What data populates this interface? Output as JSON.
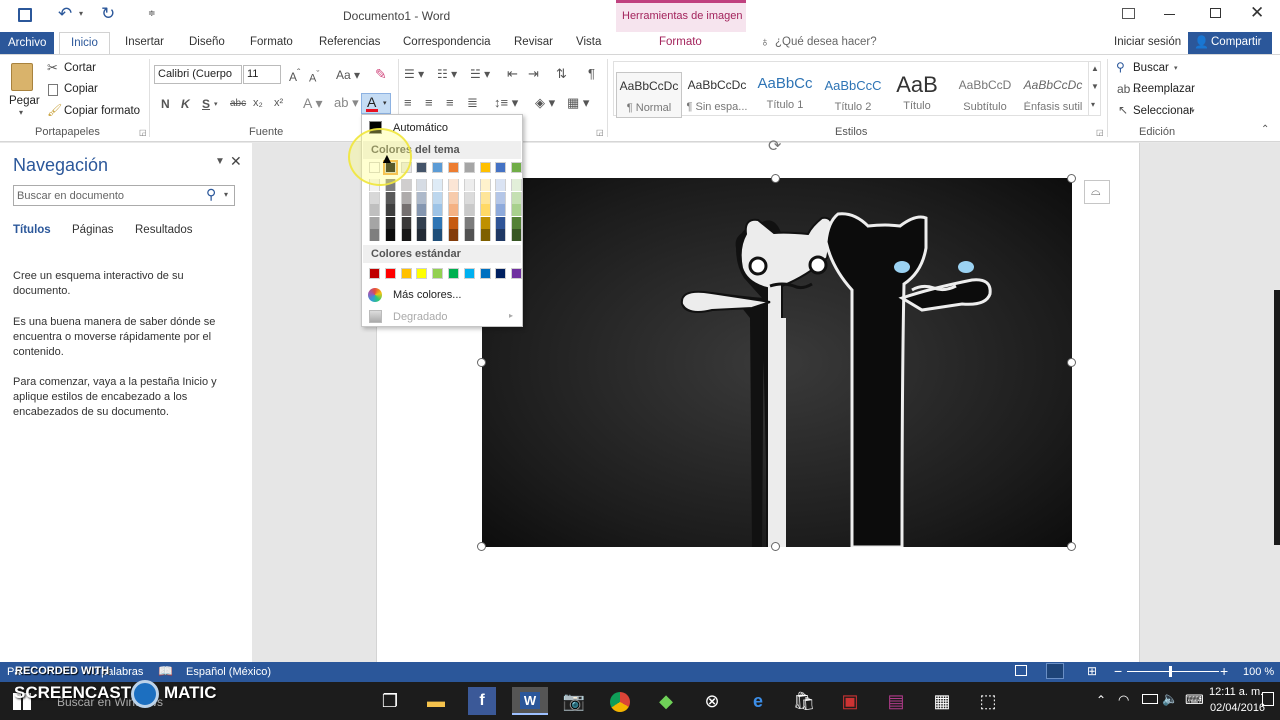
{
  "window": {
    "title": "Documento1 - Word",
    "context_tab_group": "Herramientas de imagen",
    "context_tab": "Formato",
    "controls": [
      "restore-ribbon",
      "minimize",
      "maximize",
      "close"
    ]
  },
  "qat": {
    "save": "save-icon",
    "undo": "undo-icon",
    "redo": "redo-icon"
  },
  "tabs": {
    "archivo": "Archivo",
    "inicio": "Inicio",
    "insertar": "Insertar",
    "diseno": "Diseño",
    "formato": "Formato",
    "referencias": "Referencias",
    "correspondencia": "Correspondencia",
    "revisar": "Revisar",
    "vista": "Vista",
    "tell_me": "¿Qué desea hacer?",
    "sign_in": "Iniciar sesión",
    "share": "Compartir"
  },
  "ribbon": {
    "portapapeles": {
      "label": "Portapapeles",
      "paste": "Pegar",
      "cut": "Cortar",
      "copy": "Copiar",
      "format_painter": "Copiar formato"
    },
    "fuente": {
      "label": "Fuente",
      "font_name": "Calibri (Cuerpo",
      "font_size": "11",
      "bold": "N",
      "italic": "K",
      "underline": "S",
      "strike": "abc",
      "subscript": "x₂",
      "superscript": "x²",
      "font_color": "A",
      "font_color_value": "#e81123"
    },
    "parrafo": {
      "pilcrow": "¶"
    },
    "estilos": {
      "label": "Estilos",
      "items": [
        {
          "sample": "AaBbCcDc",
          "name": "¶ Normal"
        },
        {
          "sample": "AaBbCcDc",
          "name": "¶ Sin espa..."
        },
        {
          "sample": "AaBbCc",
          "name": "Título 1"
        },
        {
          "sample": "AaBbCcC",
          "name": "Título 2"
        },
        {
          "sample": "AaB",
          "name": "Título"
        },
        {
          "sample": "AaBbCcD",
          "name": "Subtítulo"
        },
        {
          "sample": "AaBbCcDc",
          "name": "Énfasis sutil"
        }
      ]
    },
    "edicion": {
      "label": "Edición",
      "find": "Buscar",
      "replace": "Reemplazar",
      "select": "Seleccionar"
    }
  },
  "color_menu": {
    "automatic": "Automático",
    "theme_header": "Colores del tema",
    "theme_top": [
      "#ffffff",
      "#000000",
      "#e7e6e6",
      "#44546a",
      "#5b9bd5",
      "#ed7d31",
      "#a5a5a5",
      "#ffc000",
      "#4472c4",
      "#70ad47"
    ],
    "theme_shades": [
      [
        "#f2f2f2",
        "#7f7f7f",
        "#d0cece",
        "#d6dce4",
        "#deebf6",
        "#fbe5d5",
        "#ededed",
        "#fff2cc",
        "#dae3f3",
        "#e2efd9"
      ],
      [
        "#d8d8d8",
        "#595959",
        "#aeabab",
        "#adb9ca",
        "#bdd7ee",
        "#f7cbac",
        "#dbdbdb",
        "#fee599",
        "#b4c6e7",
        "#c5e0b3"
      ],
      [
        "#bfbfbf",
        "#3f3f3f",
        "#757070",
        "#8496b0",
        "#9dc3e6",
        "#f4b183",
        "#c9c9c9",
        "#ffd965",
        "#8eaadb",
        "#a8d08d"
      ],
      [
        "#a5a5a5",
        "#262626",
        "#3a3838",
        "#323f4f",
        "#2e75b5",
        "#c55a11",
        "#7b7b7b",
        "#bf9000",
        "#2f5496",
        "#538135"
      ],
      [
        "#7f7f7f",
        "#0c0c0c",
        "#171616",
        "#222a35",
        "#1e4e79",
        "#833c0b",
        "#525252",
        "#7f6000",
        "#1f3864",
        "#375623"
      ]
    ],
    "standard_header": "Colores estándar",
    "standard": [
      "#c00000",
      "#ff0000",
      "#ffc000",
      "#ffff00",
      "#92d050",
      "#00b050",
      "#00b0f0",
      "#0070c0",
      "#002060",
      "#7030a0"
    ],
    "more_colors": "Más colores...",
    "gradient": "Degradado"
  },
  "nav": {
    "title": "Navegación",
    "search_placeholder": "Buscar en documento",
    "tabs": [
      "Títulos",
      "Páginas",
      "Resultados"
    ],
    "p1": "Cree un esquema interactivo de su documento.",
    "p2": "Es una buena manera de saber dónde se encuentra o moverse rápidamente por el contenido.",
    "p3": "Para comenzar, vaya a la pestaña Inicio y aplique estilos de encabezado a los encabezados de su documento."
  },
  "status": {
    "page": "Pá",
    "words": "0 palabras",
    "language": "Español (México)",
    "zoom": "100 %",
    "zoom_minus": "−",
    "zoom_plus": "+"
  },
  "watermark": {
    "recorded": "RECORDED WITH",
    "brand_left": "SCREENCAST",
    "brand_right": "MATIC"
  },
  "taskbar": {
    "search": "Buscar en Windows",
    "time": "12:11 a. m.",
    "date": "02/04/2016"
  }
}
